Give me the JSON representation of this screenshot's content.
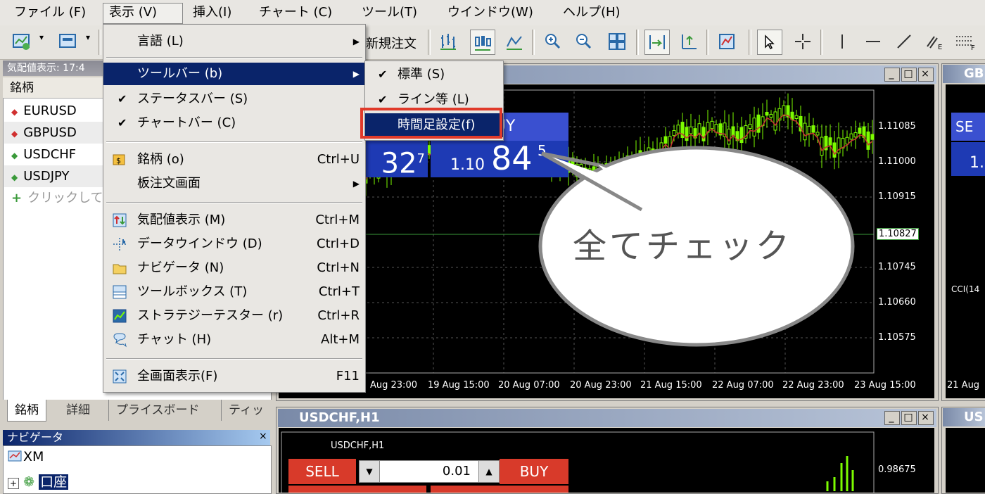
{
  "menubar": {
    "items": [
      "ファイル (F)",
      "表示 (V)",
      "挿入(I)",
      "チャート (C)",
      "ツール(T)",
      "ウインドウ(W)",
      "ヘルプ(H)"
    ]
  },
  "toolbar": {
    "new_order_label": "新規注文"
  },
  "market_watch": {
    "title": "気配値表示: 17:4",
    "header": "銘柄",
    "rows": [
      {
        "symbol": "EURUSD",
        "dir": "down"
      },
      {
        "symbol": "GBPUSD",
        "dir": "down"
      },
      {
        "symbol": "USDCHF",
        "dir": "up"
      },
      {
        "symbol": "USDJPY",
        "dir": "up"
      }
    ],
    "add_label": "クリックして",
    "tabs": [
      "銘柄",
      "詳細",
      "プライスボード",
      "ティッ"
    ]
  },
  "navigator": {
    "title": "ナビゲータ",
    "close": "×",
    "root": "XM",
    "account": "口座"
  },
  "view_menu": {
    "items": [
      {
        "label": "言語 (L)",
        "shortcut": "",
        "submenu": true
      },
      {
        "label": "ツールバー (b)",
        "shortcut": "",
        "submenu": true,
        "highlight": true
      },
      {
        "label": "ステータスバー (S)",
        "shortcut": "",
        "checked": true
      },
      {
        "label": "チャートバー (C)",
        "shortcut": "",
        "checked": true
      },
      {
        "label": "銘柄 (o)",
        "shortcut": "Ctrl+U"
      },
      {
        "label": "板注文画面",
        "shortcut": "",
        "submenu": true
      },
      {
        "label": "気配値表示 (M)",
        "shortcut": "Ctrl+M"
      },
      {
        "label": "データウインドウ (D)",
        "shortcut": "Ctrl+D"
      },
      {
        "label": "ナビゲータ (N)",
        "shortcut": "Ctrl+N"
      },
      {
        "label": "ツールボックス (T)",
        "shortcut": "Ctrl+T"
      },
      {
        "label": "ストラテジーテスター (r)",
        "shortcut": "Ctrl+R"
      },
      {
        "label": "チャット (H)",
        "shortcut": "Alt+M"
      },
      {
        "label": "全画面表示(F)",
        "shortcut": "F11"
      }
    ]
  },
  "toolbar_submenu": {
    "items": [
      {
        "label": "標準 (S)",
        "checked": true
      },
      {
        "label": "ライン等 (L)",
        "checked": true
      },
      {
        "label": "時間足設定(f)",
        "checked": false,
        "highlight": true
      }
    ]
  },
  "chart_main": {
    "buy_label": "BUY",
    "sell_price_tail": "32",
    "sell_price_sup": "7",
    "buy_price_main": "1.10",
    "buy_price_big": "84",
    "buy_price_sup": "5",
    "price_levels": [
      "1.11085",
      "1.11000",
      "1.10915",
      "1.10827",
      "1.10745",
      "1.10660",
      "1.10575"
    ],
    "time_labels": [
      "Aug 23:00",
      "19 Aug 15:00",
      "20 Aug 07:00",
      "20 Aug 23:00",
      "21 Aug 15:00",
      "22 Aug 07:00",
      "22 Aug 23:00",
      "23 Aug 15:00"
    ]
  },
  "chart_right": {
    "title": "GB",
    "sell_label": "SE",
    "price_frag": "1.",
    "indicator": "CCI(14",
    "time_label": "21 Aug"
  },
  "chart_usdchf": {
    "title": "USDCHF,H1",
    "subtitle": "USDCHF,H1",
    "sell_label": "SELL",
    "buy_label": "BUY",
    "lot": "0.01",
    "price_level": "0.98675"
  },
  "chart_us": {
    "title": "US"
  },
  "callout": {
    "text": "全てチェック"
  },
  "colors": {
    "candle": "#7cfc00",
    "ma": "#c83232",
    "menu_highlight": "#0a246a",
    "callout_border": "#e03a2a"
  }
}
